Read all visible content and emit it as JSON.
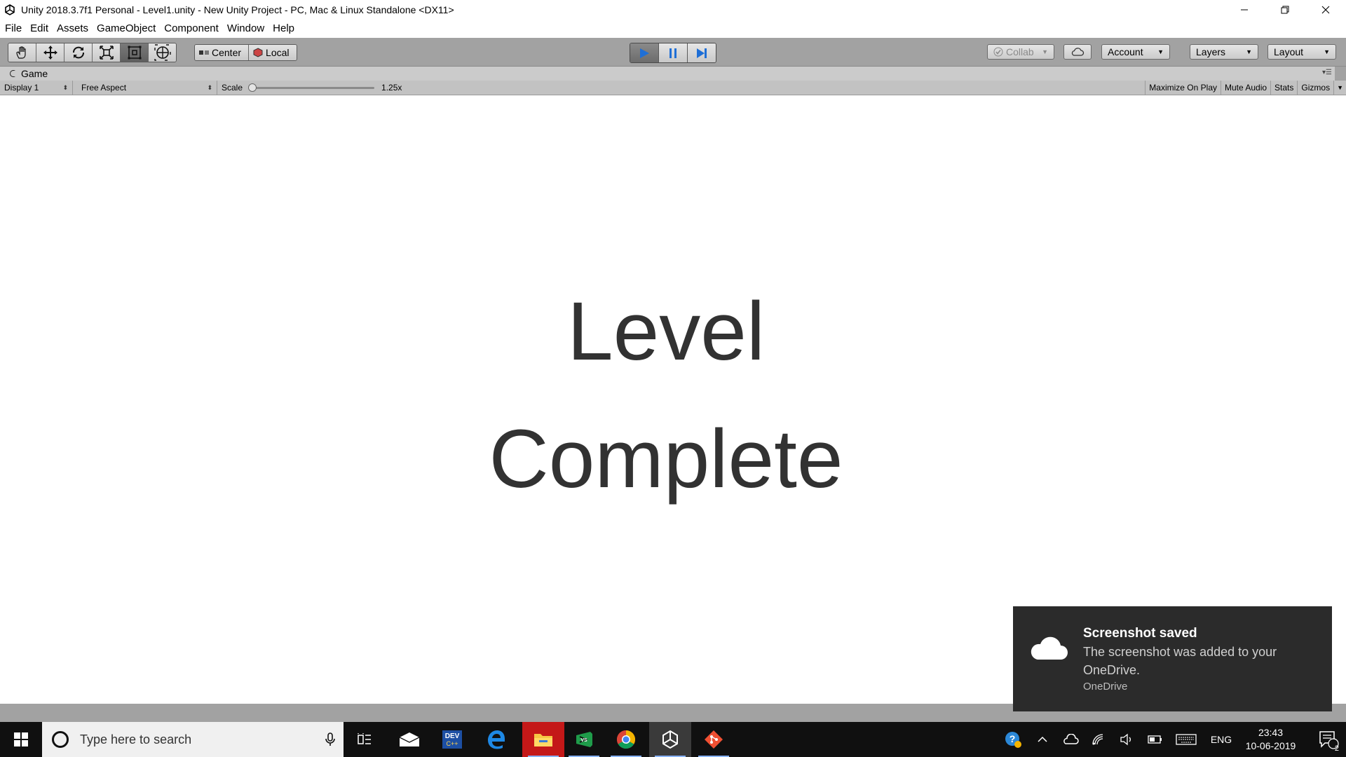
{
  "window": {
    "title": "Unity 2018.3.7f1 Personal - Level1.unity - New Unity Project - PC, Mac & Linux Standalone <DX11>"
  },
  "menu": [
    "File",
    "Edit",
    "Assets",
    "GameObject",
    "Component",
    "Window",
    "Help"
  ],
  "toolbar": {
    "tools": [
      "hand-tool-icon",
      "move-tool-icon",
      "rotate-tool-icon",
      "scale-tool-icon",
      "rect-tool-icon",
      "transform-tool-icon"
    ],
    "active_tool": "rect-tool-icon",
    "pivot_label": "Center",
    "space_label": "Local",
    "play_state": "playing",
    "collab_label": "Collab",
    "account_label": "Account",
    "layers_label": "Layers",
    "layout_label": "Layout",
    "accent_color": "#1f6fd6"
  },
  "game_panel": {
    "tab_label": "Game",
    "display_label": "Display 1",
    "aspect_label": "Free Aspect",
    "scale_label": "Scale",
    "scale_value": "1.25x",
    "toggles": [
      "Maximize On Play",
      "Mute Audio",
      "Stats",
      "Gizmos"
    ]
  },
  "game_view": {
    "line1": "Level",
    "line2": "Complete",
    "text_color": "#323232"
  },
  "toast": {
    "title": "Screenshot saved",
    "body": "The screenshot was added to your OneDrive.",
    "source": "OneDrive"
  },
  "taskbar": {
    "search_placeholder": "Type here to search",
    "language": "ENG",
    "time": "23:43",
    "date": "10-06-2019",
    "notification_count": "2"
  }
}
